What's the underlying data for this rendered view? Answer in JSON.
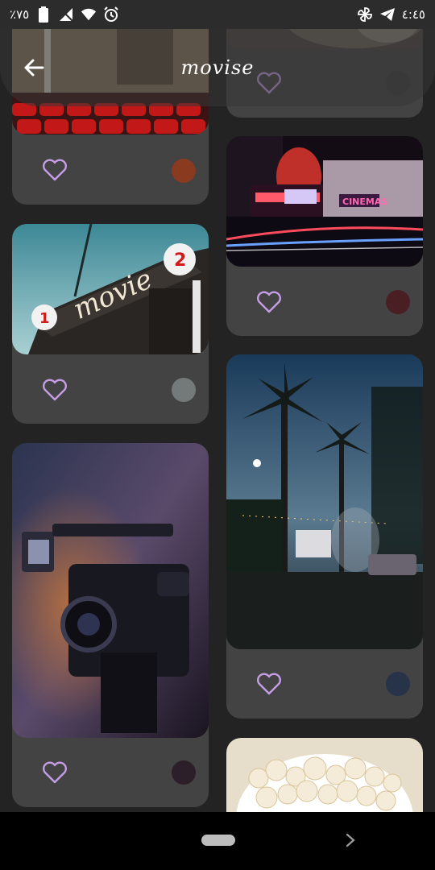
{
  "status_bar": {
    "battery_text": "٪٧٥",
    "time": "٤:٤٥",
    "icons": [
      "battery-icon",
      "no-signal-icon",
      "wifi-icon",
      "alarm-icon",
      "pinwheel-icon",
      "telegram-icon"
    ]
  },
  "app_bar": {
    "title": "movise",
    "back_icon": "arrow-left-icon"
  },
  "cards": [
    {
      "column": "left",
      "image": "cinema-seats-photo",
      "favorite_icon": "heart-outline-icon",
      "dot_color": "#8a3a1e"
    },
    {
      "column": "left",
      "image": "movie-2-sign-photo",
      "favorite_icon": "heart-outline-icon",
      "dot_color": "#74797a"
    },
    {
      "column": "left",
      "image": "film-camera-photo",
      "favorite_icon": "heart-outline-icon",
      "dot_color": "#2c1f2a"
    },
    {
      "column": "right",
      "image": "top-partial-photo",
      "favorite_icon": "heart-outline-icon",
      "dot_color": "#3c3c3c"
    },
    {
      "column": "right",
      "image": "cinema-night-street-photo",
      "favorite_icon": "heart-outline-icon",
      "dot_color": "#4a1f24"
    },
    {
      "column": "right",
      "image": "outdoor-palm-cinema-photo",
      "favorite_icon": "heart-outline-icon",
      "dot_color": "#263348"
    },
    {
      "column": "right",
      "image": "popcorn-photo",
      "favorite_icon": "heart-outline-icon",
      "dot_color": ""
    }
  ],
  "colors": {
    "background": "#232323",
    "card": "#434343",
    "heart": "#c59ee6"
  },
  "nav_bar": {
    "home_icon": "home-pill-icon",
    "forward_icon": "chevron-right-icon"
  }
}
